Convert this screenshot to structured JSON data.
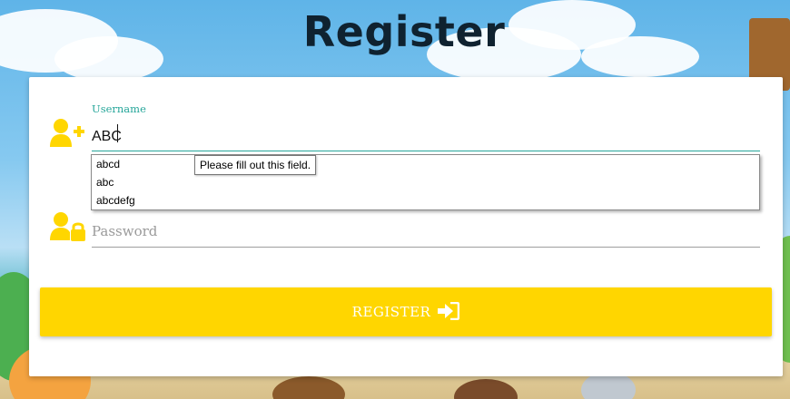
{
  "page": {
    "title": "Register"
  },
  "form": {
    "username": {
      "label": "Username",
      "value": "ABC",
      "icon": "user-plus-icon"
    },
    "password": {
      "placeholder": "Password",
      "icon": "user-lock-icon"
    },
    "submit": {
      "label": "REGISTER",
      "icon": "sign-in-icon"
    }
  },
  "autocomplete": {
    "suggestions": [
      "abcd",
      "abc",
      "abcdefg"
    ]
  },
  "validation": {
    "tooltip": "Please fill out this field."
  },
  "colors": {
    "accent": "#26a69a",
    "button": "#ffd600",
    "icon": "#ffd600",
    "title": "#0f2230"
  }
}
